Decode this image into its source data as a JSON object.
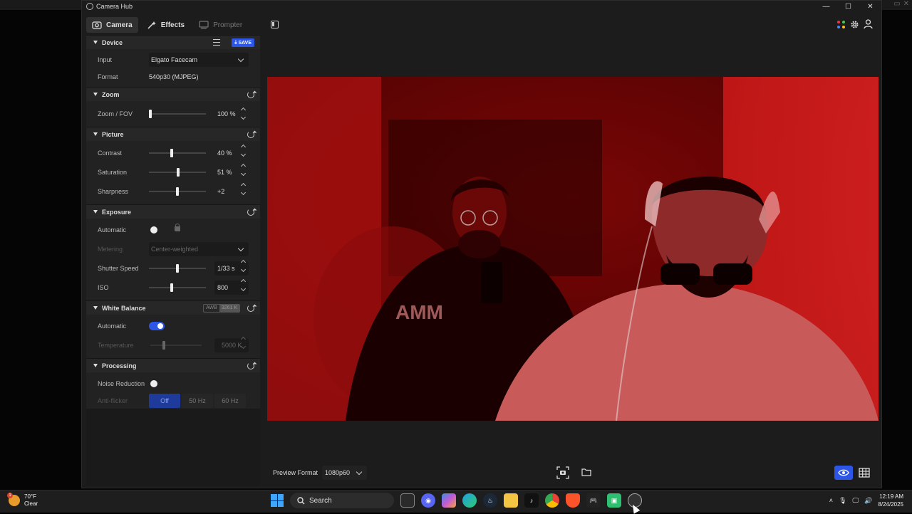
{
  "window": {
    "title": "Camera Hub"
  },
  "tabs": [
    {
      "label": "Camera",
      "icon": "camera-icon",
      "state": "active"
    },
    {
      "label": "Effects",
      "icon": "wand-icon",
      "state": "normal"
    },
    {
      "label": "Prompter",
      "icon": "prompter-icon",
      "state": "dim"
    }
  ],
  "device": {
    "title": "Device",
    "save_label": "SAVE",
    "input_label": "Input",
    "input_value": "Elgato Facecam",
    "format_label": "Format",
    "format_value": "540p30 (MJPEG)"
  },
  "zoom": {
    "title": "Zoom",
    "fov_label": "Zoom / FOV",
    "fov_value": "100 %",
    "fov_level": 0.0
  },
  "picture": {
    "title": "Picture",
    "contrast_label": "Contrast",
    "contrast_value": "40 %",
    "contrast_level": 0.4,
    "saturation_label": "Saturation",
    "saturation_value": "51 %",
    "saturation_level": 0.51,
    "sharpness_label": "Sharpness",
    "sharpness_value": "+2",
    "sharpness_level": 0.5
  },
  "exposure": {
    "title": "Exposure",
    "automatic_label": "Automatic",
    "automatic_on": false,
    "metering_label": "Metering",
    "metering_value": "Center-weighted",
    "shutter_label": "Shutter Speed",
    "shutter_value": "1/33 s",
    "shutter_level": 0.5,
    "iso_label": "ISO",
    "iso_value": "800",
    "iso_level": 0.4
  },
  "white_balance": {
    "title": "White Balance",
    "awb_label": "AWB",
    "awb_value": "3261 K",
    "automatic_label": "Automatic",
    "automatic_on": true,
    "temperature_label": "Temperature",
    "temperature_value": "5000 K",
    "temperature_level": 0.25
  },
  "processing": {
    "title": "Processing",
    "noise_label": "Noise Reduction",
    "noise_on": false,
    "antiflicker_label": "Anti-flicker",
    "antiflicker_options": [
      "Off",
      "50 Hz",
      "60 Hz"
    ],
    "antiflicker_selected": "Off"
  },
  "bottom": {
    "preview_format_label": "Preview Format",
    "preview_format_value": "1080p60"
  },
  "taskbar": {
    "weather_temp": "70°F",
    "weather_desc": "Clear",
    "weather_badge": "1",
    "search_placeholder": "Search",
    "time": "12:19 AM",
    "date": "8/24/2025"
  },
  "colors": {
    "accent": "#2d55e6",
    "preview_tint": "#b01010"
  }
}
